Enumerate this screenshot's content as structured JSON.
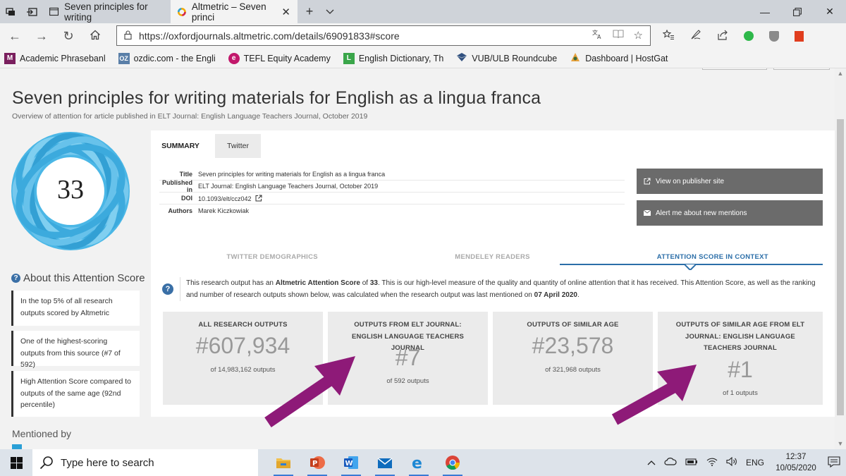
{
  "browser": {
    "tabs": [
      {
        "label": "Seven principles for writing",
        "active": false
      },
      {
        "label": "Altmetric – Seven princi",
        "active": true
      }
    ],
    "url": "https://oxfordjournals.altmetric.com/details/69091833#score",
    "bookmarks": [
      {
        "label": "Academic Phrasebanl",
        "icon": "M",
        "color": "#7a1f5e"
      },
      {
        "label": "ozdic.com - the Engli",
        "icon": "OZ",
        "color": "#5a7fa8"
      },
      {
        "label": "TEFL Equity Academy",
        "icon": "e",
        "color": "#c2186b"
      },
      {
        "label": "English Dictionary, Th",
        "icon": "L",
        "color": "#3aa64a"
      },
      {
        "label": "VUB/ULB Roundcube",
        "icon": "roundcube-icon",
        "color": "#2f4f7f"
      },
      {
        "label": "Dashboard | HostGat",
        "icon": "hostgator-icon",
        "color": "#e8a13a"
      }
    ]
  },
  "article": {
    "title": "Seven principles for writing materials for English as a lingua franca",
    "subtitle": "Overview of attention for article published in ELT Journal: English Language Teachers Journal, October 2019",
    "score": "33"
  },
  "about": {
    "heading": "About this Attention Score",
    "items": [
      "In the top 5% of all research outputs scored by Altmetric",
      "One of the highest-scoring outputs from this source (#7 of 592)",
      "High Attention Score compared to outputs of the same age (92nd percentile)"
    ]
  },
  "mentioned_by": {
    "heading": "Mentioned by"
  },
  "tabs": {
    "summary": "SUMMARY",
    "twitter": "Twitter"
  },
  "meta": [
    {
      "key": "Title",
      "value": "Seven principles for writing materials for English as a lingua franca"
    },
    {
      "key": "Published in",
      "value": "ELT Journal: English Language Teachers Journal, October 2019"
    },
    {
      "key": "DOI",
      "value": "10.1093/elt/ccz042"
    },
    {
      "key": "Authors",
      "value": "Marek Kiczkowiak"
    }
  ],
  "buttons": {
    "publisher": "View on publisher site",
    "alert": "Alert me about new mentions"
  },
  "section_tabs": [
    "TWITTER DEMOGRAPHICS",
    "MENDELEY READERS",
    "ATTENTION SCORE IN CONTEXT"
  ],
  "explanation": {
    "p1": "This research output has an ",
    "b1": "Altmetric Attention Score",
    "p2": " of ",
    "b2": "33",
    "p3": ". This is our high-level measure of the quality and quantity of online attention that it has received. This Attention Score, as well as the ranking and number of research outputs shown below, was calculated when the research output was last mentioned on ",
    "b3": "07 April 2020",
    "p4": "."
  },
  "stats": [
    {
      "heading": "ALL RESEARCH OUTPUTS",
      "rank": "#607,934",
      "outof": "of 14,983,162 outputs"
    },
    {
      "heading": "OUTPUTS FROM ELT JOURNAL: ENGLISH LANGUAGE TEACHERS JOURNAL",
      "rank": "#7",
      "outof": "of 592 outputs"
    },
    {
      "heading": "OUTPUTS OF SIMILAR AGE",
      "rank": "#23,578",
      "outof": "of 321,968 outputs"
    },
    {
      "heading": "OUTPUTS OF SIMILAR AGE FROM ELT JOURNAL: ENGLISH LANGUAGE TEACHERS JOURNAL",
      "rank": "#1",
      "outof": "of 1 outputs"
    }
  ],
  "taskbar": {
    "search_placeholder": "Type here to search",
    "lang": "ENG",
    "time": "12:37",
    "date": "10/05/2020"
  },
  "colors": {
    "accent_blue": "#2b6ea8",
    "arrow_purple": "#8e1a78",
    "donut_blue": "#3aa8dc",
    "button_grey": "#6b6b6b"
  }
}
